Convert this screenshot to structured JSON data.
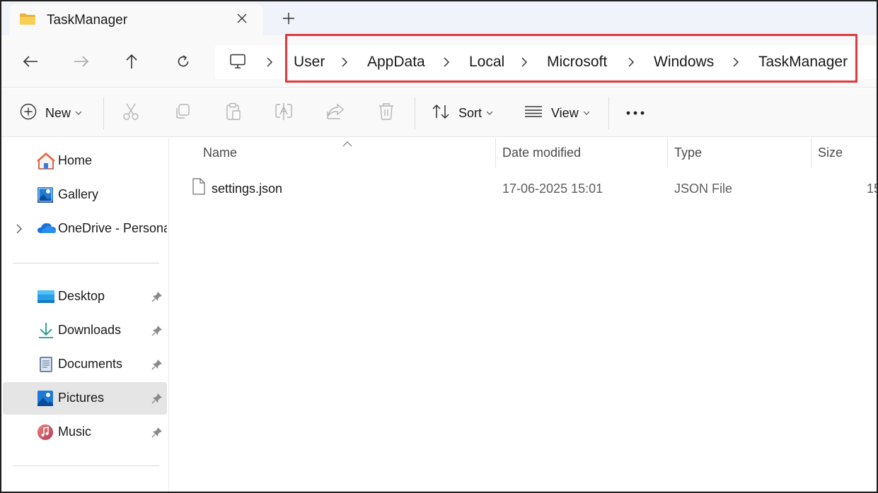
{
  "tab": {
    "title": "TaskManager"
  },
  "breadcrumb": {
    "items": [
      "User",
      "AppData",
      "Local",
      "Microsoft",
      "Windows",
      "TaskManager"
    ]
  },
  "toolbar": {
    "new_label": "New",
    "sort_label": "Sort",
    "view_label": "View"
  },
  "sidebar": {
    "top_items": [
      {
        "label": "Home",
        "icon": "home-icon"
      },
      {
        "label": "Gallery",
        "icon": "gallery-icon"
      },
      {
        "label": "OneDrive - Personal",
        "icon": "onedrive-icon"
      }
    ],
    "pinned_items": [
      {
        "label": "Desktop",
        "icon": "desktop-icon"
      },
      {
        "label": "Downloads",
        "icon": "downloads-icon"
      },
      {
        "label": "Documents",
        "icon": "documents-icon"
      },
      {
        "label": "Pictures",
        "icon": "pictures-icon",
        "selected": true
      },
      {
        "label": "Music",
        "icon": "music-icon"
      }
    ]
  },
  "columns": {
    "name": "Name",
    "date": "Date modified",
    "type": "Type",
    "size": "Size"
  },
  "files": [
    {
      "name": "settings.json",
      "date": "17-06-2025 15:01",
      "type": "JSON File",
      "size": "15"
    }
  ],
  "colors": {
    "highlight": "#e0393b",
    "accent": "#0067c0"
  }
}
